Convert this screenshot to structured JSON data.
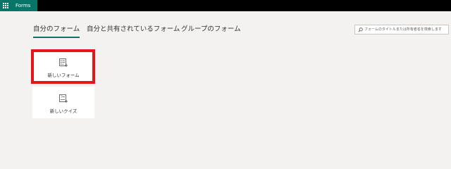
{
  "header": {
    "app_name": "Forms",
    "app_bar_color": "#077568"
  },
  "tabs": [
    {
      "label": "自分のフォーム",
      "active": true
    },
    {
      "label": "自分と共有されているフォーム",
      "active": false
    },
    {
      "label": "グループのフォーム",
      "active": false
    }
  ],
  "search": {
    "placeholder": "フォームのタイトルまたは所有者名を検索します",
    "icon": "search-icon"
  },
  "cards": {
    "new_form": {
      "label": "新しいフォーム",
      "icon": "new-form-icon"
    },
    "new_quiz": {
      "label": "新しいクイズ",
      "icon": "new-quiz-icon"
    }
  },
  "annotation": {
    "color": "#e8141b",
    "target": "new_form"
  }
}
